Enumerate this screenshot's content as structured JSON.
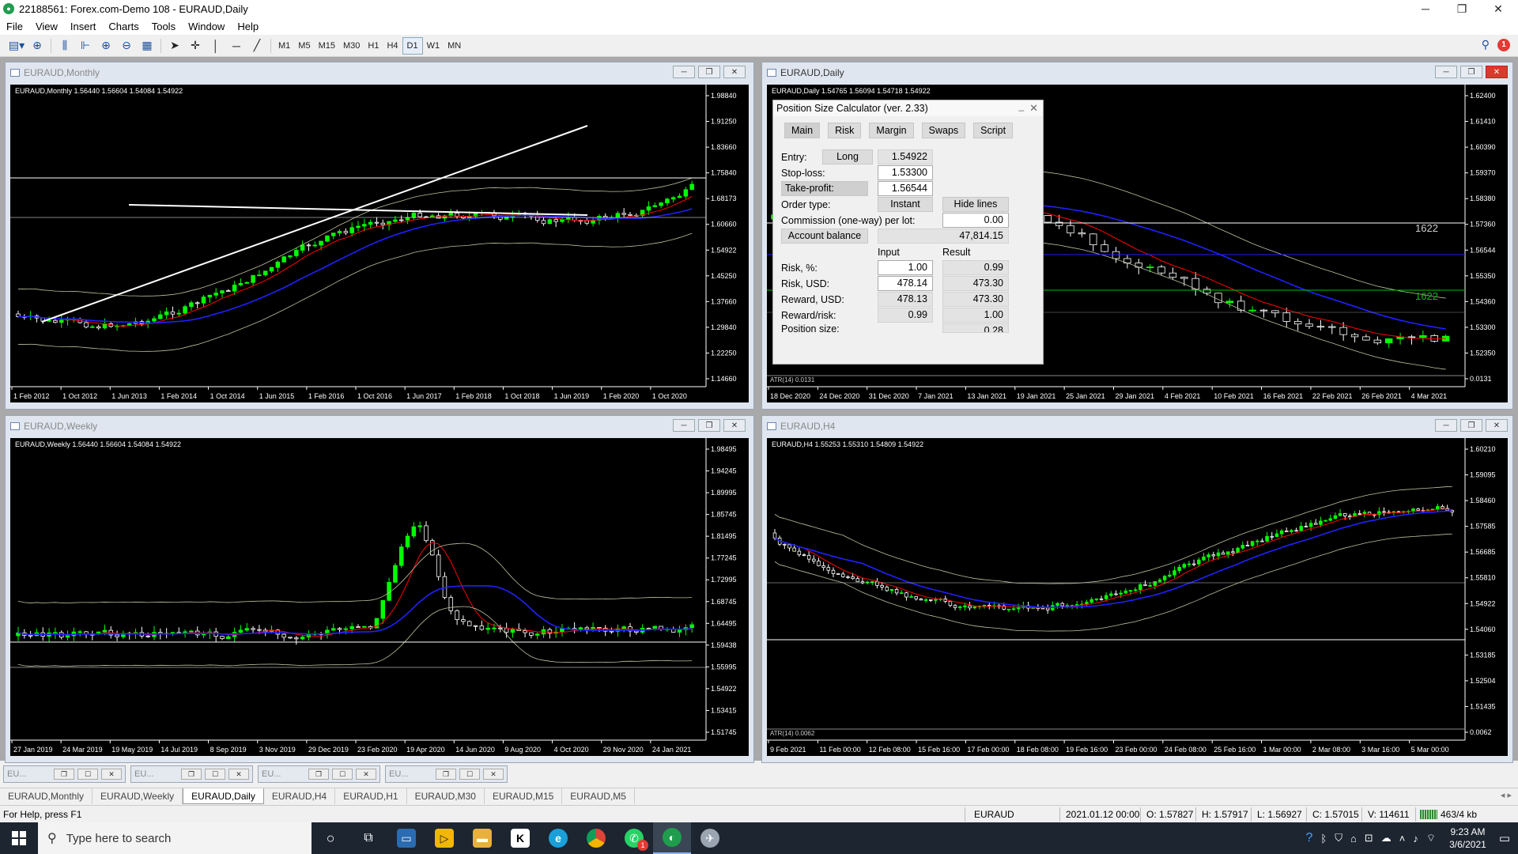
{
  "window": {
    "title": "22188561: Forex.com-Demo 108 - EURAUD,Daily"
  },
  "menu": [
    "File",
    "View",
    "Insert",
    "Charts",
    "Tools",
    "Window",
    "Help"
  ],
  "toolbar": {
    "timeframes": [
      "M1",
      "M5",
      "M15",
      "M30",
      "H1",
      "H4",
      "D1",
      "W1",
      "MN"
    ],
    "active_timeframe": "D1",
    "notification_count": "1"
  },
  "charts": {
    "monthly": {
      "title": "EURAUD,Monthly",
      "info": "EURAUD,Monthly  1.56440 1.56604 1.54084 1.54922",
      "price_labels": [
        "1.98840",
        "1.91250",
        "1.83660",
        "1.75840",
        "1.68173",
        "1.60660",
        "1.54922",
        "1.45250",
        "1.37660",
        "1.29840",
        "1.22250",
        "1.14660"
      ],
      "date_labels": [
        "1 Feb 2012",
        "1 Oct 2012",
        "1 Jun 2013",
        "1 Feb 2014",
        "1 Oct 2014",
        "1 Jun 2015",
        "1 Feb 2016",
        "1 Oct 2016",
        "1 Jun 2017",
        "1 Feb 2018",
        "1 Oct 2018",
        "1 Jun 2019",
        "1 Feb 2020",
        "1 Oct 2020"
      ]
    },
    "daily": {
      "title": "EURAUD,Daily",
      "info": "EURAUD,Daily  1.54765 1.56094 1.54718 1.54922",
      "price_labels": [
        "1.62400",
        "1.61410",
        "1.60390",
        "1.59370",
        "1.58380",
        "1.57360",
        "1.56544",
        "1.55350",
        "1.54360",
        "1.53300",
        "1.52350",
        "0.0131"
      ],
      "date_labels": [
        "18 Dec 2020",
        "24 Dec 2020",
        "31 Dec 2020",
        "7 Jan 2021",
        "13 Jan 2021",
        "19 Jan 2021",
        "25 Jan 2021",
        "29 Jan 2021",
        "4 Feb 2021",
        "10 Feb 2021",
        "16 Feb 2021",
        "22 Feb 2021",
        "26 Feb 2021",
        "4 Mar 2021"
      ],
      "line_labels": [
        "1622",
        "1622"
      ],
      "atr": "ATR(14) 0.0131"
    },
    "weekly": {
      "title": "EURAUD,Weekly",
      "info": "EURAUD,Weekly  1.56440 1.56604 1.54084 1.54922",
      "price_labels": [
        "1.98495",
        "1.94245",
        "1.89995",
        "1.85745",
        "1.81495",
        "1.77245",
        "1.72995",
        "1.68745",
        "1.64495",
        "1.59438",
        "1.55995",
        "1.54922",
        "1.53415",
        "1.51745"
      ],
      "date_labels": [
        "27 Jan 2019",
        "24 Mar 2019",
        "19 May 2019",
        "14 Jul 2019",
        "8 Sep 2019",
        "3 Nov 2019",
        "29 Dec 2019",
        "23 Feb 2020",
        "19 Apr 2020",
        "14 Jun 2020",
        "9 Aug 2020",
        "4 Oct 2020",
        "29 Nov 2020",
        "24 Jan 2021"
      ]
    },
    "h4": {
      "title": "EURAUD,H4",
      "info": "EURAUD,H4  1.55253 1.55310 1.54809 1.54922",
      "price_labels": [
        "1.60210",
        "1.59095",
        "1.58460",
        "1.57585",
        "1.56685",
        "1.55810",
        "1.54922",
        "1.54060",
        "1.53185",
        "1.52504",
        "1.51435",
        "0.0062"
      ],
      "date_labels": [
        "9 Feb 2021",
        "11 Feb 00:00",
        "12 Feb 08:00",
        "15 Feb 16:00",
        "17 Feb 00:00",
        "18 Feb 08:00",
        "19 Feb 16:00",
        "23 Feb 00:00",
        "24 Feb 08:00",
        "25 Feb 16:00",
        "1 Mar 00:00",
        "2 Mar 08:00",
        "3 Mar 16:00",
        "5 Mar 00:00"
      ],
      "atr": "ATR(14) 0.0062"
    }
  },
  "psc": {
    "title": "Position Size Calculator (ver. 2.33)",
    "tabs": [
      "Main",
      "Risk",
      "Margin",
      "Swaps",
      "Script"
    ],
    "entry_label": "Entry:",
    "direction": "Long",
    "entry": "1.54922",
    "stoploss_label": "Stop-loss:",
    "stoploss": "1.53300",
    "takeprofit_label": "Take-profit:",
    "takeprofit": "1.56544",
    "ordertype_label": "Order type:",
    "ordertype": "Instant",
    "hide_lines": "Hide lines",
    "commission_label": "Commission (one-way) per lot:",
    "commission": "0.00",
    "account_balance_label": "Account balance",
    "account_balance": "47,814.15",
    "input_header": "Input",
    "result_header": "Result",
    "risk_pct_label": "Risk, %:",
    "risk_pct_in": "1.00",
    "risk_pct_out": "0.99",
    "risk_usd_label": "Risk, USD:",
    "risk_usd_in": "478.14",
    "risk_usd_out": "473.30",
    "reward_usd_label": "Reward, USD:",
    "reward_usd_in": "478.13",
    "reward_usd_out": "473.30",
    "reward_risk_label": "Reward/risk:",
    "reward_risk_in": "0.99",
    "reward_risk_out": "1.00",
    "position_size_label": "Position size:",
    "position_size": "0.28"
  },
  "minimized": [
    "EU...",
    "EU...",
    "EU...",
    "EU..."
  ],
  "tabs": [
    "EURAUD,Monthly",
    "EURAUD,Weekly",
    "EURAUD,Daily",
    "EURAUD,H4",
    "EURAUD,H1",
    "EURAUD,M30",
    "EURAUD,M15",
    "EURAUD,M5"
  ],
  "active_tab": "EURAUD,Daily",
  "status": {
    "help": "For Help, press F1",
    "symbol": "EURAUD",
    "datetime": "2021.01.12 00:00",
    "open": "O: 1.57827",
    "high": "H: 1.57917",
    "low": "L: 1.56927",
    "close": "C: 1.57015",
    "volume": "V: 114611",
    "traffic": "463/4 kb"
  },
  "taskbar": {
    "search_placeholder": "Type here to search",
    "time": "9:23 AM",
    "date": "3/6/2021",
    "whatsapp_badge": "1"
  },
  "colors": {
    "bull": "#00ff00",
    "bear": "#ffffff",
    "ma_red": "#ff0000",
    "ma_blue": "#2020ff",
    "band": "#c0c0a0",
    "accent": "#1f9d4d"
  }
}
